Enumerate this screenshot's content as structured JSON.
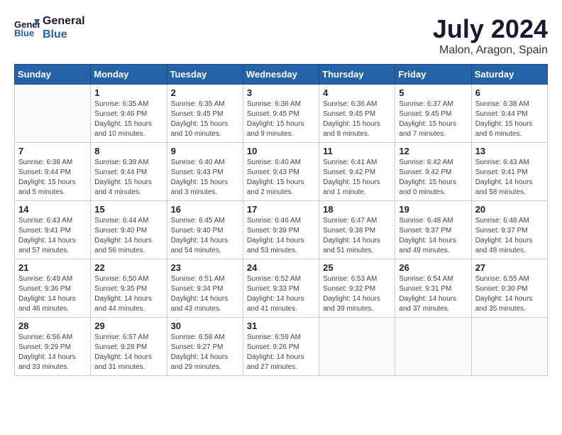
{
  "header": {
    "logo_line1": "General",
    "logo_line2": "Blue",
    "month": "July 2024",
    "location": "Malon, Aragon, Spain"
  },
  "weekdays": [
    "Sunday",
    "Monday",
    "Tuesday",
    "Wednesday",
    "Thursday",
    "Friday",
    "Saturday"
  ],
  "weeks": [
    [
      {
        "day": "",
        "info": ""
      },
      {
        "day": "1",
        "info": "Sunrise: 6:35 AM\nSunset: 9:46 PM\nDaylight: 15 hours\nand 10 minutes."
      },
      {
        "day": "2",
        "info": "Sunrise: 6:35 AM\nSunset: 9:45 PM\nDaylight: 15 hours\nand 10 minutes."
      },
      {
        "day": "3",
        "info": "Sunrise: 6:36 AM\nSunset: 9:45 PM\nDaylight: 15 hours\nand 9 minutes."
      },
      {
        "day": "4",
        "info": "Sunrise: 6:36 AM\nSunset: 9:45 PM\nDaylight: 15 hours\nand 8 minutes."
      },
      {
        "day": "5",
        "info": "Sunrise: 6:37 AM\nSunset: 9:45 PM\nDaylight: 15 hours\nand 7 minutes."
      },
      {
        "day": "6",
        "info": "Sunrise: 6:38 AM\nSunset: 9:44 PM\nDaylight: 15 hours\nand 6 minutes."
      }
    ],
    [
      {
        "day": "7",
        "info": "Sunrise: 6:38 AM\nSunset: 9:44 PM\nDaylight: 15 hours\nand 5 minutes."
      },
      {
        "day": "8",
        "info": "Sunrise: 6:39 AM\nSunset: 9:44 PM\nDaylight: 15 hours\nand 4 minutes."
      },
      {
        "day": "9",
        "info": "Sunrise: 6:40 AM\nSunset: 9:43 PM\nDaylight: 15 hours\nand 3 minutes."
      },
      {
        "day": "10",
        "info": "Sunrise: 6:40 AM\nSunset: 9:43 PM\nDaylight: 15 hours\nand 2 minutes."
      },
      {
        "day": "11",
        "info": "Sunrise: 6:41 AM\nSunset: 9:42 PM\nDaylight: 15 hours\nand 1 minute."
      },
      {
        "day": "12",
        "info": "Sunrise: 6:42 AM\nSunset: 9:42 PM\nDaylight: 15 hours\nand 0 minutes."
      },
      {
        "day": "13",
        "info": "Sunrise: 6:43 AM\nSunset: 9:41 PM\nDaylight: 14 hours\nand 58 minutes."
      }
    ],
    [
      {
        "day": "14",
        "info": "Sunrise: 6:43 AM\nSunset: 9:41 PM\nDaylight: 14 hours\nand 57 minutes."
      },
      {
        "day": "15",
        "info": "Sunrise: 6:44 AM\nSunset: 9:40 PM\nDaylight: 14 hours\nand 56 minutes."
      },
      {
        "day": "16",
        "info": "Sunrise: 6:45 AM\nSunset: 9:40 PM\nDaylight: 14 hours\nand 54 minutes."
      },
      {
        "day": "17",
        "info": "Sunrise: 6:46 AM\nSunset: 9:39 PM\nDaylight: 14 hours\nand 53 minutes."
      },
      {
        "day": "18",
        "info": "Sunrise: 6:47 AM\nSunset: 9:38 PM\nDaylight: 14 hours\nand 51 minutes."
      },
      {
        "day": "19",
        "info": "Sunrise: 6:48 AM\nSunset: 9:37 PM\nDaylight: 14 hours\nand 49 minutes."
      },
      {
        "day": "20",
        "info": "Sunrise: 6:48 AM\nSunset: 9:37 PM\nDaylight: 14 hours\nand 48 minutes."
      }
    ],
    [
      {
        "day": "21",
        "info": "Sunrise: 6:49 AM\nSunset: 9:36 PM\nDaylight: 14 hours\nand 46 minutes."
      },
      {
        "day": "22",
        "info": "Sunrise: 6:50 AM\nSunset: 9:35 PM\nDaylight: 14 hours\nand 44 minutes."
      },
      {
        "day": "23",
        "info": "Sunrise: 6:51 AM\nSunset: 9:34 PM\nDaylight: 14 hours\nand 43 minutes."
      },
      {
        "day": "24",
        "info": "Sunrise: 6:52 AM\nSunset: 9:33 PM\nDaylight: 14 hours\nand 41 minutes."
      },
      {
        "day": "25",
        "info": "Sunrise: 6:53 AM\nSunset: 9:32 PM\nDaylight: 14 hours\nand 39 minutes."
      },
      {
        "day": "26",
        "info": "Sunrise: 6:54 AM\nSunset: 9:31 PM\nDaylight: 14 hours\nand 37 minutes."
      },
      {
        "day": "27",
        "info": "Sunrise: 6:55 AM\nSunset: 9:30 PM\nDaylight: 14 hours\nand 35 minutes."
      }
    ],
    [
      {
        "day": "28",
        "info": "Sunrise: 6:56 AM\nSunset: 9:29 PM\nDaylight: 14 hours\nand 33 minutes."
      },
      {
        "day": "29",
        "info": "Sunrise: 6:57 AM\nSunset: 9:28 PM\nDaylight: 14 hours\nand 31 minutes."
      },
      {
        "day": "30",
        "info": "Sunrise: 6:58 AM\nSunset: 9:27 PM\nDaylight: 14 hours\nand 29 minutes."
      },
      {
        "day": "31",
        "info": "Sunrise: 6:59 AM\nSunset: 9:26 PM\nDaylight: 14 hours\nand 27 minutes."
      },
      {
        "day": "",
        "info": ""
      },
      {
        "day": "",
        "info": ""
      },
      {
        "day": "",
        "info": ""
      }
    ]
  ]
}
